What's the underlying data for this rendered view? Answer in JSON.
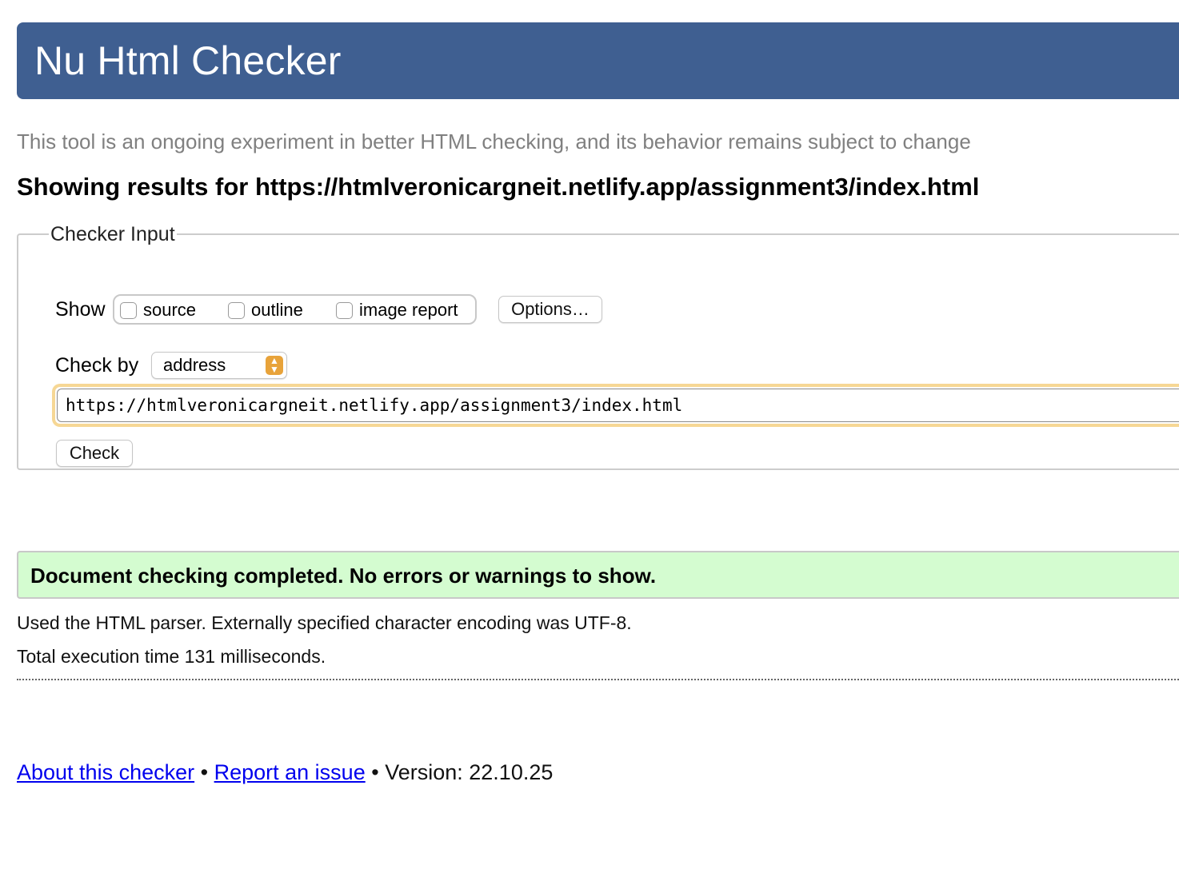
{
  "header": {
    "title": "Nu Html Checker"
  },
  "subtitle": "This tool is an ongoing experiment in better HTML checking, and its behavior remains subject to change",
  "results_heading": "Showing results for https://htmlveronicargneit.netlify.app/assignment3/index.html",
  "checker_input": {
    "legend": "Checker Input",
    "show_label": "Show",
    "options": [
      {
        "label": "source",
        "checked": false
      },
      {
        "label": "outline",
        "checked": false
      },
      {
        "label": "image report",
        "checked": false
      }
    ],
    "options_button": "Options…",
    "check_by_label": "Check by",
    "check_by_value": "address",
    "url_value": "https://htmlveronicargneit.netlify.app/assignment3/index.html",
    "check_button": "Check"
  },
  "status": {
    "message": "Document checking completed. No errors or warnings to show.",
    "color": "#d4fcd0"
  },
  "info": {
    "parser": "Used the HTML parser. Externally specified character encoding was UTF-8.",
    "execution_time": "Total execution time 131 milliseconds."
  },
  "footer": {
    "about_link": "About this checker",
    "separator": "•",
    "report_link": "Report an issue",
    "version": "Version: 22.10.25"
  },
  "colors": {
    "header_bg": "#3f5f91",
    "focus_ring": "#f6d795",
    "select_accent": "#e8a33a",
    "link": "#0000ee"
  }
}
